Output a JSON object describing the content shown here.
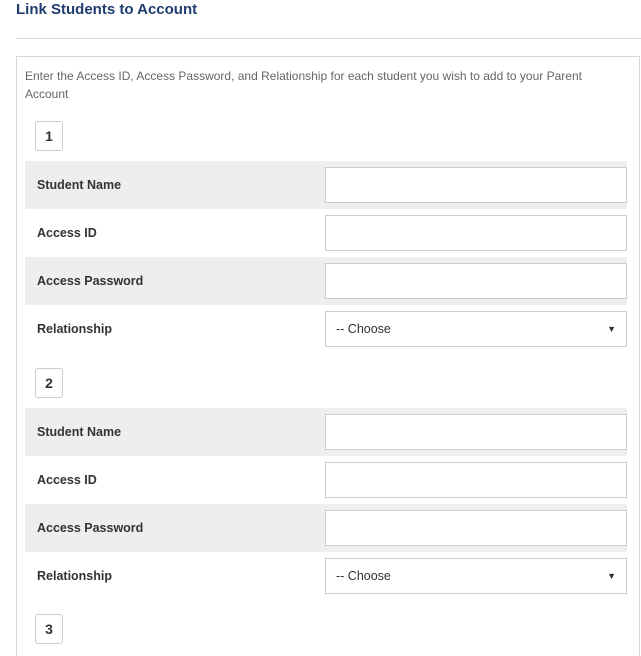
{
  "title": "Link Students to Account",
  "intro": "Enter the Access ID, Access Password, and Relationship for each student you wish to add to your Parent Account",
  "labels": {
    "student_name": "Student Name",
    "access_id": "Access ID",
    "access_password": "Access Password",
    "relationship": "Relationship"
  },
  "relationship_selected": "-- Choose",
  "students": [
    {
      "number": "1",
      "student_name": "",
      "access_id": "",
      "access_password": "",
      "relationship": "-- Choose"
    },
    {
      "number": "2",
      "student_name": "",
      "access_id": "",
      "access_password": "",
      "relationship": "-- Choose"
    },
    {
      "number": "3"
    }
  ],
  "icons": {
    "select_caret": "caret-down-icon"
  }
}
